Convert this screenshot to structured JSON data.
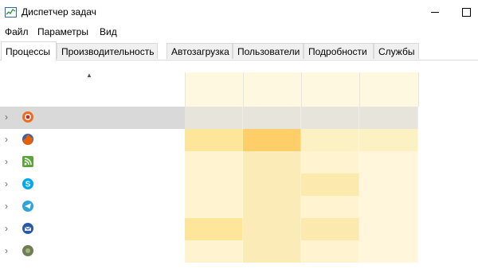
{
  "window": {
    "title": "Диспетчер задач"
  },
  "menu": {
    "items": [
      "Файл",
      "Параметры",
      "Вид"
    ]
  },
  "tabs": [
    {
      "label": "Процессы",
      "active": true
    },
    {
      "label": "Производительность",
      "active": false
    },
    {
      "label": "Автозагрузка",
      "active": false
    },
    {
      "label": "Пользователи",
      "active": false
    },
    {
      "label": "Подробности",
      "active": false
    },
    {
      "label": "Службы",
      "active": false
    }
  ],
  "sort": {
    "column": "name",
    "direction": "ascending"
  },
  "processes": [
    {
      "icon": "avast-icon",
      "selected": true,
      "heat": [
        "#e6e4db",
        "#e6e4db",
        "#e6e4db",
        "#e6e4db"
      ]
    },
    {
      "icon": "firefox-icon",
      "selected": false,
      "heat": [
        "#fde59a",
        "#fecf69",
        "#fcf1c3",
        "#fcf1c3"
      ]
    },
    {
      "icon": "rss-icon",
      "selected": false,
      "heat": [
        "#fff4cf",
        "#fbebb6",
        "#fff4cf",
        "#fff6db"
      ]
    },
    {
      "icon": "skype-icon",
      "selected": false,
      "heat": [
        "#fff4cf",
        "#fbebb6",
        "#fbe9ae",
        "#fff6db"
      ]
    },
    {
      "icon": "telegram-icon",
      "selected": false,
      "heat": [
        "#fff4cf",
        "#fbebb6",
        "#fff4cf",
        "#fff6db"
      ]
    },
    {
      "icon": "thunderbird-icon",
      "selected": false,
      "heat": [
        "#fde59a",
        "#fbebb6",
        "#fbe9ae",
        "#fff6db"
      ]
    },
    {
      "icon": "app-icon-green",
      "selected": false,
      "heat": [
        "#fff4cf",
        "#fbebb6",
        "#fff4cf",
        "#fff6db"
      ]
    }
  ],
  "colors": {
    "selected_row": "#d9d9d9",
    "heat_header": "#fff8e0"
  }
}
